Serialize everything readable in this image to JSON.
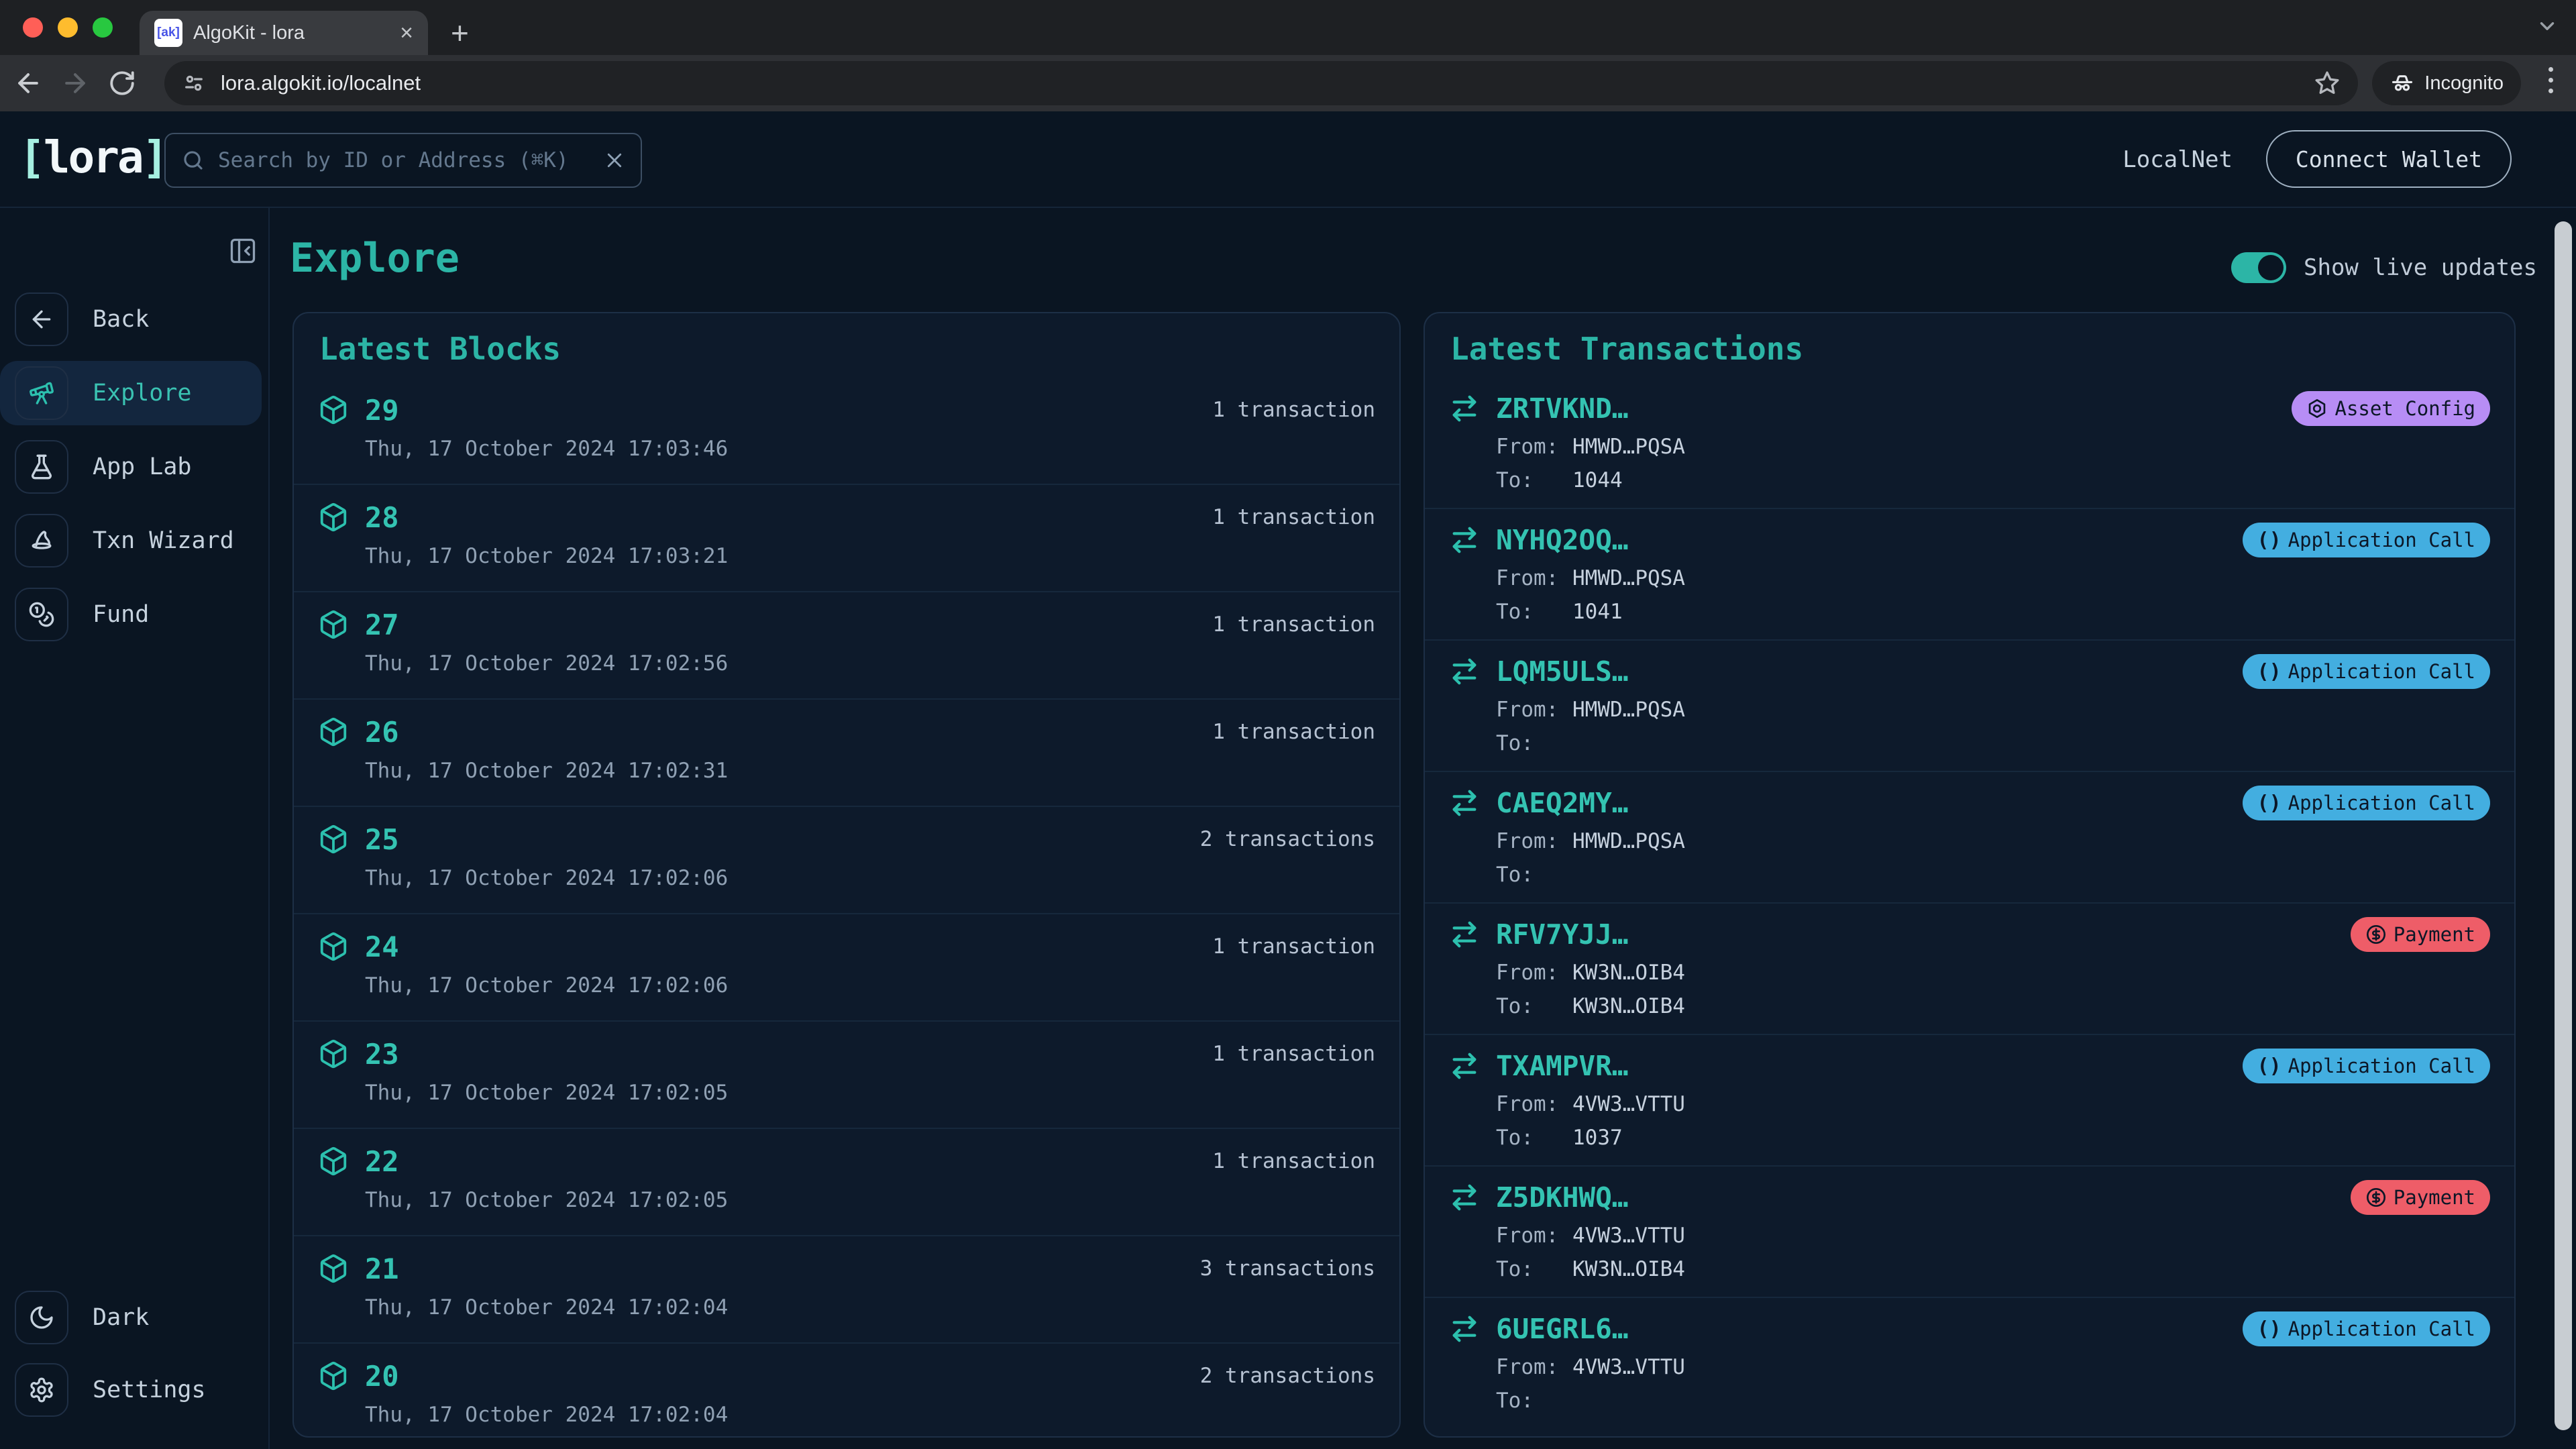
{
  "colors": {
    "accent": "#2cb5a6",
    "page_bg": "#0a1522",
    "card_bg": "#0d1a2b",
    "badge_asset_config": "#b78df5",
    "badge_app_call": "#43aee0",
    "badge_payment": "#ee5d68"
  },
  "browser": {
    "tab_title": "AlgoKit - lora",
    "favicon_text": "[ak]",
    "url": "lora.algokit.io/localnet",
    "incognito_label": "Incognito"
  },
  "header": {
    "logo_left": "[",
    "logo_text": "lora",
    "logo_right": "]",
    "search_placeholder": "Search by ID or Address (⌘K)",
    "network_label": "LocalNet",
    "connect_wallet_label": "Connect Wallet"
  },
  "sidebar": {
    "items": [
      {
        "label": "Back"
      },
      {
        "label": "Explore"
      },
      {
        "label": "App Lab"
      },
      {
        "label": "Txn Wizard"
      },
      {
        "label": "Fund"
      }
    ],
    "footer_items": [
      {
        "label": "Dark"
      },
      {
        "label": "Settings"
      }
    ]
  },
  "page": {
    "title": "Explore",
    "live_updates_label": "Show live updates"
  },
  "latest_blocks": {
    "title": "Latest Blocks",
    "rows": [
      {
        "number": "29",
        "count": "1 transaction",
        "timestamp": "Thu, 17 October 2024 17:03:46"
      },
      {
        "number": "28",
        "count": "1 transaction",
        "timestamp": "Thu, 17 October 2024 17:03:21"
      },
      {
        "number": "27",
        "count": "1 transaction",
        "timestamp": "Thu, 17 October 2024 17:02:56"
      },
      {
        "number": "26",
        "count": "1 transaction",
        "timestamp": "Thu, 17 October 2024 17:02:31"
      },
      {
        "number": "25",
        "count": "2 transactions",
        "timestamp": "Thu, 17 October 2024 17:02:06"
      },
      {
        "number": "24",
        "count": "1 transaction",
        "timestamp": "Thu, 17 October 2024 17:02:06"
      },
      {
        "number": "23",
        "count": "1 transaction",
        "timestamp": "Thu, 17 October 2024 17:02:05"
      },
      {
        "number": "22",
        "count": "1 transaction",
        "timestamp": "Thu, 17 October 2024 17:02:05"
      },
      {
        "number": "21",
        "count": "3 transactions",
        "timestamp": "Thu, 17 October 2024 17:02:04"
      },
      {
        "number": "20",
        "count": "2 transactions",
        "timestamp": "Thu, 17 October 2024 17:02:04"
      }
    ]
  },
  "latest_transactions": {
    "title": "Latest Transactions",
    "from_label": "From:",
    "to_label": "To:",
    "rows": [
      {
        "id": "ZRTVKND…",
        "type": "Asset Config",
        "from": "HMWD…PQSA",
        "to": "1044"
      },
      {
        "id": "NYHQ2OQ…",
        "type": "Application Call",
        "from": "HMWD…PQSA",
        "to": "1041"
      },
      {
        "id": "LQM5ULS…",
        "type": "Application Call",
        "from": "HMWD…PQSA",
        "to": ""
      },
      {
        "id": "CAEQ2MY…",
        "type": "Application Call",
        "from": "HMWD…PQSA",
        "to": ""
      },
      {
        "id": "RFV7YJJ…",
        "type": "Payment",
        "from": "KW3N…OIB4",
        "to": "KW3N…OIB4"
      },
      {
        "id": "TXAMPVR…",
        "type": "Application Call",
        "from": "4VW3…VTTU",
        "to": "1037"
      },
      {
        "id": "Z5DKHWQ…",
        "type": "Payment",
        "from": "4VW3…VTTU",
        "to": "KW3N…OIB4"
      },
      {
        "id": "6UEGRL6…",
        "type": "Application Call",
        "from": "4VW3…VTTU",
        "to": ""
      }
    ]
  }
}
